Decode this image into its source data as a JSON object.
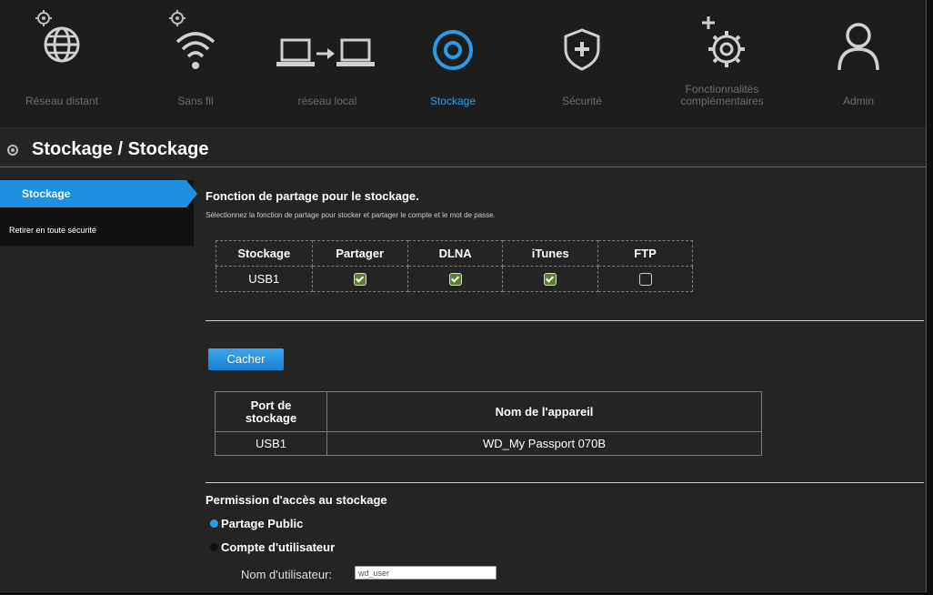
{
  "nav": {
    "items": [
      {
        "label": "Réseau distant",
        "icon": "globe-icon"
      },
      {
        "label": "Sans fil",
        "icon": "wifi-icon"
      },
      {
        "label": "réseau local",
        "icon": "lan-icon"
      },
      {
        "label": "Stockage",
        "icon": "storage-icon",
        "active": true
      },
      {
        "label": "Sécurité",
        "icon": "shield-icon"
      },
      {
        "label_line1": "Fonctionnalités",
        "label_line2": "complémentaires",
        "icon": "gear-plus-icon"
      },
      {
        "label": "Admin",
        "icon": "user-icon"
      }
    ],
    "active_color": "#2b9be8"
  },
  "page_title": "Stockage / Stockage",
  "sidebar": {
    "items": [
      {
        "label": "Stockage",
        "active": true
      },
      {
        "label": "Retirer en toute sécurité"
      }
    ]
  },
  "sharing": {
    "title": "Fonction de partage pour le stockage.",
    "description": "Sélectionnez la fonction de partage pour stocker et partager le compte et le mot de passe.",
    "headers": [
      "Stockage",
      "Partager",
      "DLNA",
      "iTunes",
      "FTP"
    ],
    "row": {
      "name": "USB1",
      "partager": true,
      "dlna": true,
      "itunes": true,
      "ftp": false
    }
  },
  "cacher_button": "Cacher",
  "devices": {
    "headers": [
      "Port de stockage",
      "Nom de l'appareil"
    ],
    "header_port_line1": "Port de",
    "header_port_line2": "stockage",
    "rows": [
      {
        "port": "USB1",
        "name": "WD_My Passport 070B"
      }
    ]
  },
  "permission": {
    "title": "Permission d'accès au stockage",
    "options": [
      "Partage Public",
      "Compte d'utilisateur"
    ],
    "selected": "Partage Public",
    "username_label": "Nom d'utilisateur:",
    "username_value": "wd_user"
  }
}
